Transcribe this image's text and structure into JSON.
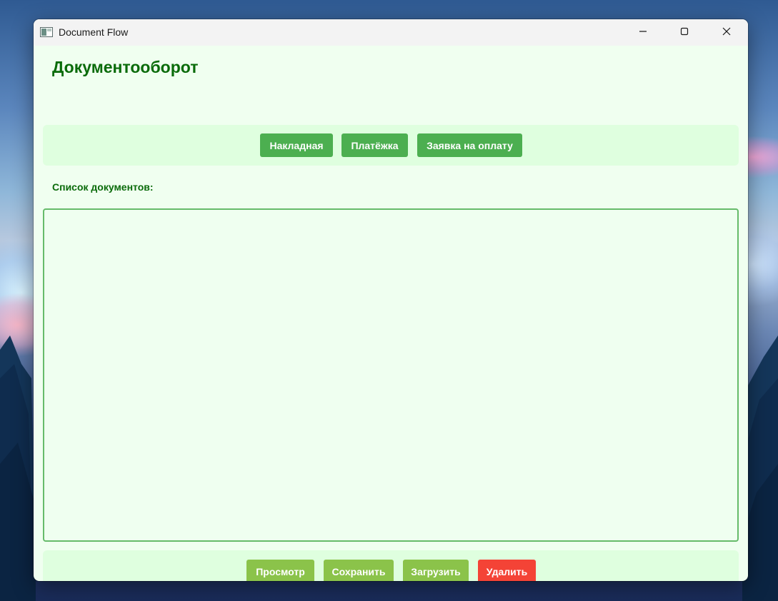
{
  "window": {
    "title": "Document Flow"
  },
  "header": {
    "title": "Документооборот"
  },
  "doc_types": {
    "buttons": [
      {
        "label": "Накладная"
      },
      {
        "label": "Платёжка"
      },
      {
        "label": "Заявка на оплату"
      }
    ]
  },
  "list": {
    "label": "Список документов:",
    "items": []
  },
  "actions": {
    "view_label": "Просмотр",
    "save_label": "Сохранить",
    "load_label": "Загрузить",
    "delete_label": "Удалить"
  },
  "colors": {
    "primary": "#4caf50",
    "secondary": "#8bc34a",
    "danger": "#f44336",
    "heading": "#0a6b0a",
    "background": "#f0fff0",
    "panel": "#dfffdf"
  },
  "icons": {
    "app": "app-window-icon",
    "minimize": "minimize-icon",
    "maximize": "maximize-icon",
    "close": "close-icon"
  }
}
